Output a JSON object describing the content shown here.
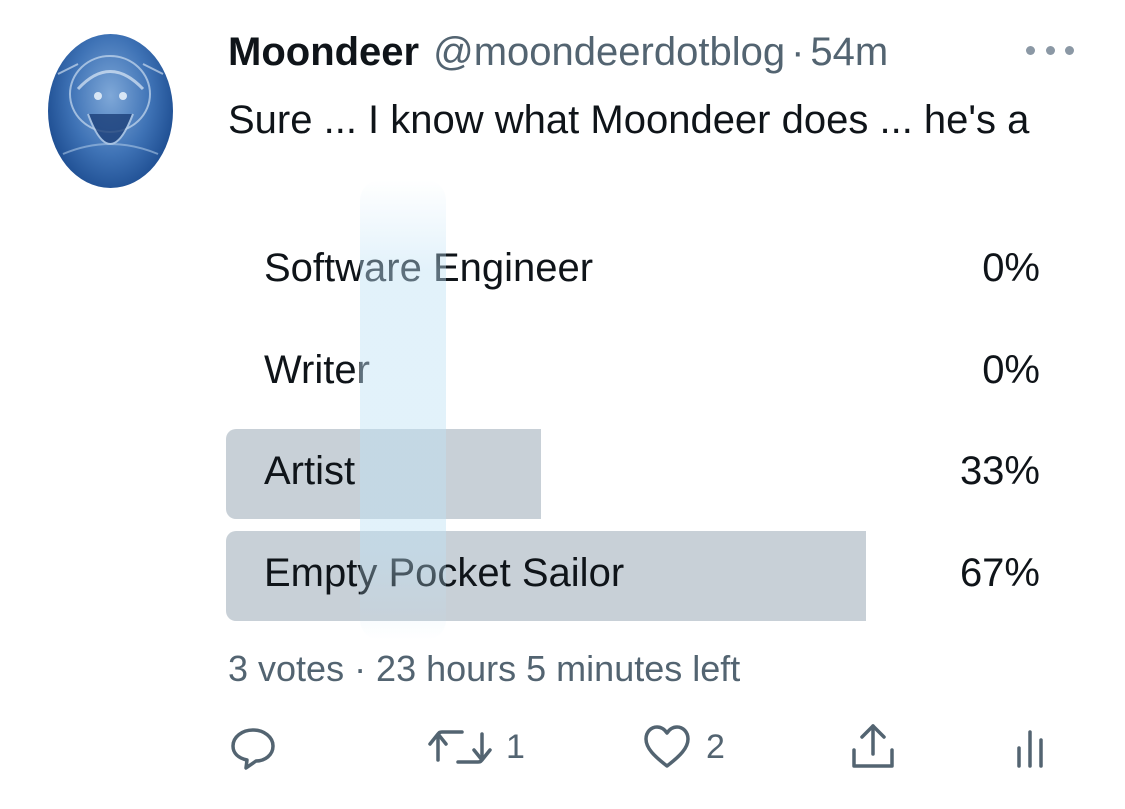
{
  "tweet": {
    "author_name": "Moondeer",
    "handle": "@moondeerdotblog",
    "separator": "·",
    "time": "54m",
    "text": "Sure ... I know what Moondeer does ... he's a"
  },
  "poll": {
    "options": [
      {
        "label": "Software Engineer",
        "percent_text": "0%",
        "percent": 0
      },
      {
        "label": "Writer",
        "percent_text": "0%",
        "percent": 0
      },
      {
        "label": "Artist",
        "percent_text": "33%",
        "percent": 33
      },
      {
        "label": "Empty Pocket Sailor",
        "percent_text": "67%",
        "percent": 67
      }
    ],
    "meta": "3 votes · 23 hours 5 minutes left"
  },
  "actions": {
    "reply_count": "",
    "retweet_count": "1",
    "like_count": "2"
  },
  "icons": {
    "more": "more-horizontal-icon",
    "reply": "reply-icon",
    "retweet": "retweet-icon",
    "like": "heart-icon",
    "share": "share-icon",
    "analytics": "analytics-icon"
  },
  "colors": {
    "text": "#0f1419",
    "secondary": "#536471",
    "poll_bar": "#c8d0d7"
  }
}
